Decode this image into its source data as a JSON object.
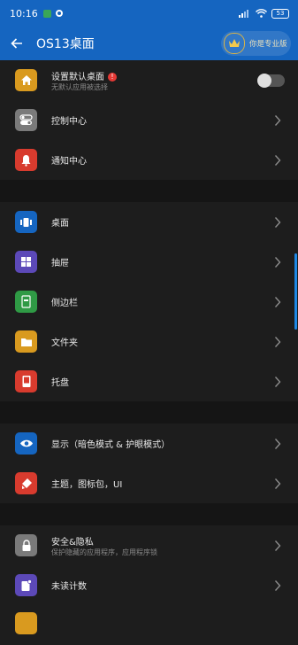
{
  "status": {
    "time": "10:16",
    "battery": "53"
  },
  "header": {
    "title": "OS13桌面",
    "pro_label": "你是专业版"
  },
  "colors": {
    "primary": "#1565c0",
    "accent": "#1e88e5"
  },
  "rows": [
    {
      "label": "设置默认桌面",
      "sub": "无默认应用被选择",
      "badge": "!",
      "icon": "home-icon",
      "color": "#d99a1f",
      "toggle": false
    },
    {
      "label": "控制中心",
      "icon": "toggles-icon",
      "color": "#7a7a7a"
    },
    {
      "label": "通知中心",
      "icon": "bell-icon",
      "color": "#d83b2e"
    },
    {
      "label": "桌面",
      "icon": "dock-icon",
      "color": "#1565c0"
    },
    {
      "label": "抽屉",
      "icon": "grid-icon",
      "color": "#5c49b8"
    },
    {
      "label": "侧边栏",
      "icon": "sidebar-icon",
      "color": "#2f9a45"
    },
    {
      "label": "文件夹",
      "icon": "folder-icon",
      "color": "#d99a1f"
    },
    {
      "label": "托盘",
      "icon": "tray-icon",
      "color": "#d83b2e"
    },
    {
      "label": "显示（暗色模式 & 护眼模式）",
      "icon": "eye-icon",
      "color": "#1565c0"
    },
    {
      "label": "主题，图标包，UI",
      "icon": "theme-icon",
      "color": "#d83b2e"
    },
    {
      "label": "安全&隐私",
      "sub": "保护隐藏的应用程序，应用程序锁",
      "icon": "lock-icon",
      "color": "#7a7a7a"
    },
    {
      "label": "未读计数",
      "icon": "badge-icon",
      "color": "#5c49b8"
    }
  ]
}
